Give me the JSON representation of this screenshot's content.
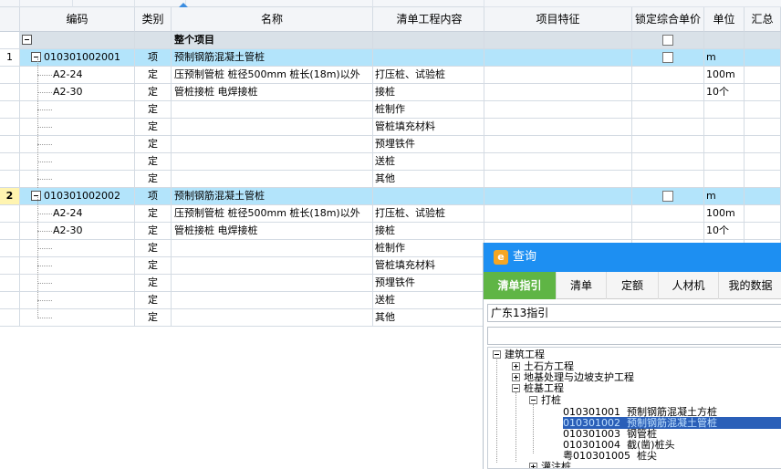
{
  "grid": {
    "headers": [
      "编码",
      "类别",
      "名称",
      "清单工程内容",
      "项目特征",
      "锁定综合单价",
      "单位",
      "汇总"
    ],
    "rows": [
      {
        "num": "",
        "code": "",
        "type": "",
        "name": "整个项目",
        "content": "",
        "unit": ""
      },
      {
        "num": "1",
        "code": "010301002001",
        "type": "项",
        "name": "预制钢筋混凝土管桩",
        "content": "",
        "unit": "m"
      },
      {
        "num": "",
        "code": "A2-24",
        "type": "定",
        "name": "压预制管桩 桩径500mm 桩长(18m)以外",
        "content": "打压桩、试验桩",
        "unit": "100m"
      },
      {
        "num": "",
        "code": "A2-30",
        "type": "定",
        "name": "管桩接桩 电焊接桩",
        "content": "接桩",
        "unit": "10个"
      },
      {
        "num": "",
        "code": "",
        "type": "定",
        "name": "",
        "content": "桩制作",
        "unit": ""
      },
      {
        "num": "",
        "code": "",
        "type": "定",
        "name": "",
        "content": "管桩填充材料",
        "unit": ""
      },
      {
        "num": "",
        "code": "",
        "type": "定",
        "name": "",
        "content": "预埋铁件",
        "unit": ""
      },
      {
        "num": "",
        "code": "",
        "type": "定",
        "name": "",
        "content": "送桩",
        "unit": ""
      },
      {
        "num": "",
        "code": "",
        "type": "定",
        "name": "",
        "content": "其他",
        "unit": ""
      },
      {
        "num": "2",
        "code": "010301002002",
        "type": "项",
        "name": "预制钢筋混凝土管桩",
        "content": "",
        "unit": "m"
      },
      {
        "num": "",
        "code": "A2-24",
        "type": "定",
        "name": "压预制管桩 桩径500mm 桩长(18m)以外",
        "content": "打压桩、试验桩",
        "unit": "100m"
      },
      {
        "num": "",
        "code": "A2-30",
        "type": "定",
        "name": "管桩接桩 电焊接桩",
        "content": "接桩",
        "unit": "10个"
      },
      {
        "num": "",
        "code": "",
        "type": "定",
        "name": "",
        "content": "桩制作",
        "unit": ""
      },
      {
        "num": "",
        "code": "",
        "type": "定",
        "name": "",
        "content": "管桩填充材料",
        "unit": ""
      },
      {
        "num": "",
        "code": "",
        "type": "定",
        "name": "",
        "content": "预埋铁件",
        "unit": ""
      },
      {
        "num": "",
        "code": "",
        "type": "定",
        "name": "",
        "content": "送桩",
        "unit": ""
      },
      {
        "num": "",
        "code": "",
        "type": "定",
        "name": "",
        "content": "其他",
        "unit": ""
      }
    ]
  },
  "query": {
    "title": "查询",
    "logo": "e",
    "tabs": [
      "清单指引",
      "清单",
      "定额",
      "人材机",
      "我的数据"
    ],
    "selector": "广东13指引",
    "tree": {
      "root": "建筑工程",
      "l1": [
        "土石方工程",
        "地基处理与边坡支护工程",
        "桩基工程"
      ],
      "l2": [
        "打桩",
        "灌注桩"
      ],
      "items": [
        {
          "code": "010301001",
          "name": "预制钢筋混凝土方桩"
        },
        {
          "code": "010301002",
          "name": "预制钢筋混凝土管桩"
        },
        {
          "code": "010301003",
          "name": "钢管桩"
        },
        {
          "code": "010301004",
          "name": "截(凿)桩头"
        },
        {
          "code": "粤010301005",
          "name": "桩尖"
        }
      ]
    }
  }
}
